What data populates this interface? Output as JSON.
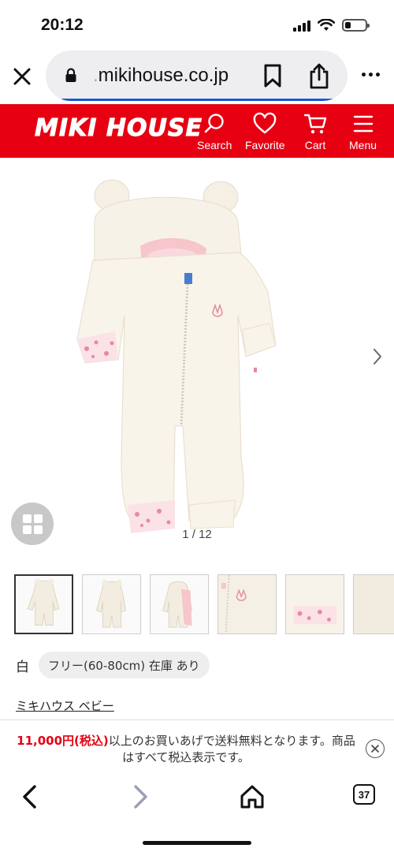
{
  "status_bar": {
    "time": "20:12"
  },
  "browser": {
    "url_prefix": ".",
    "url_domain": "mikihouse.co.jp",
    "tabs_count": "37"
  },
  "site_header": {
    "logo": "MIKI HOUSE",
    "nav": [
      {
        "label": "Search",
        "icon": "search-icon"
      },
      {
        "label": "Favorite",
        "icon": "heart-icon"
      },
      {
        "label": "Cart",
        "icon": "cart-icon"
      },
      {
        "label": "Menu",
        "icon": "menu-icon"
      }
    ]
  },
  "gallery": {
    "counter": "1 / 12",
    "current": 1,
    "total": 12
  },
  "variant": {
    "color": "白",
    "size_chip": "フリー(60-80cm) 在庫 あり"
  },
  "brand": {
    "link": "ミキハウス ベビー"
  },
  "notice": {
    "price": "11,000円",
    "tax": "(税込)",
    "text": "以上のお買いあげで送料無料となります。商品はすべて税込表示です。"
  },
  "colors": {
    "brand_red": "#e60012",
    "accent_blue": "#1a56d6"
  }
}
